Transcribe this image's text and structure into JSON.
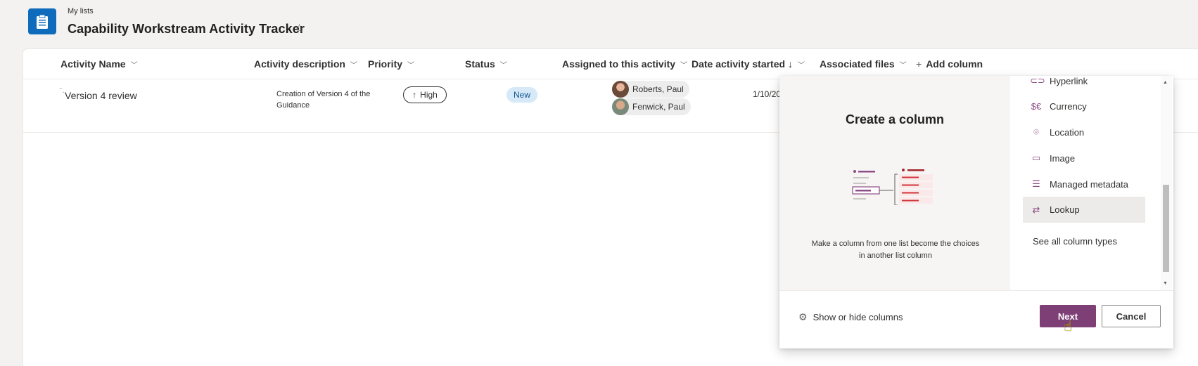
{
  "header": {
    "breadcrumb": "My lists",
    "title": "Capability Workstream Activity Tracker",
    "favorite_icon": "star-icon",
    "app_icon": "list-app-icon",
    "app_icon_color": "#0f6cbd"
  },
  "columns": [
    {
      "label": "Activity Name"
    },
    {
      "label": "Activity description"
    },
    {
      "label": "Priority"
    },
    {
      "label": "Status"
    },
    {
      "label": "Assigned to this activity"
    },
    {
      "label": "Date activity started ↓"
    },
    {
      "label": "Associated files"
    },
    {
      "label": "Add column"
    }
  ],
  "rows": [
    {
      "activity_name": "Version 4 review",
      "description": "Creation of Version 4 of the Guidance",
      "priority": "High",
      "status": "New",
      "assigned": [
        "Roberts, Paul",
        "Fenwick, Paul"
      ],
      "date_started": "1/10/20"
    }
  ],
  "panel": {
    "title": "Create a column",
    "description": "Make a column from one list become the choices in another list column",
    "types": [
      {
        "label": "Hyperlink",
        "icon": "link-icon"
      },
      {
        "label": "Currency",
        "icon": "currency-icon"
      },
      {
        "label": "Location",
        "icon": "location-icon"
      },
      {
        "label": "Image",
        "icon": "image-icon"
      },
      {
        "label": "Managed metadata",
        "icon": "metadata-icon"
      },
      {
        "label": "Lookup",
        "icon": "lookup-icon",
        "selected": true
      }
    ],
    "see_all": "See all column types",
    "show_hide": "Show or hide columns",
    "next_label": "Next",
    "cancel_label": "Cancel",
    "accent_color": "#7e3f77"
  },
  "colors": {
    "status_new_bg": "#d5e9f8",
    "status_new_text": "#0f548c"
  }
}
